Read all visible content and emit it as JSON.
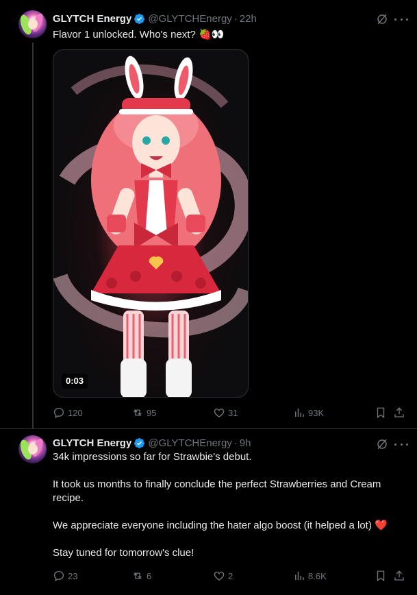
{
  "tweets": [
    {
      "author_name": "GLYTCH Energy",
      "handle": "@GLYTCHEnergy",
      "separator": "·",
      "time": "22h",
      "text_lines": [
        "Flavor 1 unlocked. Who's next? 🍓👀"
      ],
      "media": {
        "duration": "0:03"
      },
      "stats": {
        "replies": "120",
        "reposts": "95",
        "likes": "31",
        "views": "93K"
      }
    },
    {
      "author_name": "GLYTCH Energy",
      "handle": "@GLYTCHEnergy",
      "separator": "·",
      "time": "9h",
      "text_lines": [
        "34k impressions so far for Strawbie's debut.",
        "It took us months to finally conclude the perfect Strawberries and Cream recipe.",
        "We appreciate everyone including the hater algo boost (it helped a lot) ❤️",
        "Stay tuned for tomorrow's clue!"
      ],
      "stats": {
        "replies": "23",
        "reposts": "6",
        "likes": "2",
        "views": "8.6K"
      }
    }
  ],
  "colors": {
    "background": "#000000",
    "text": "#e7e9ea",
    "muted": "#71767b",
    "verified": "#1d9bf0",
    "border": "#2f3336"
  }
}
